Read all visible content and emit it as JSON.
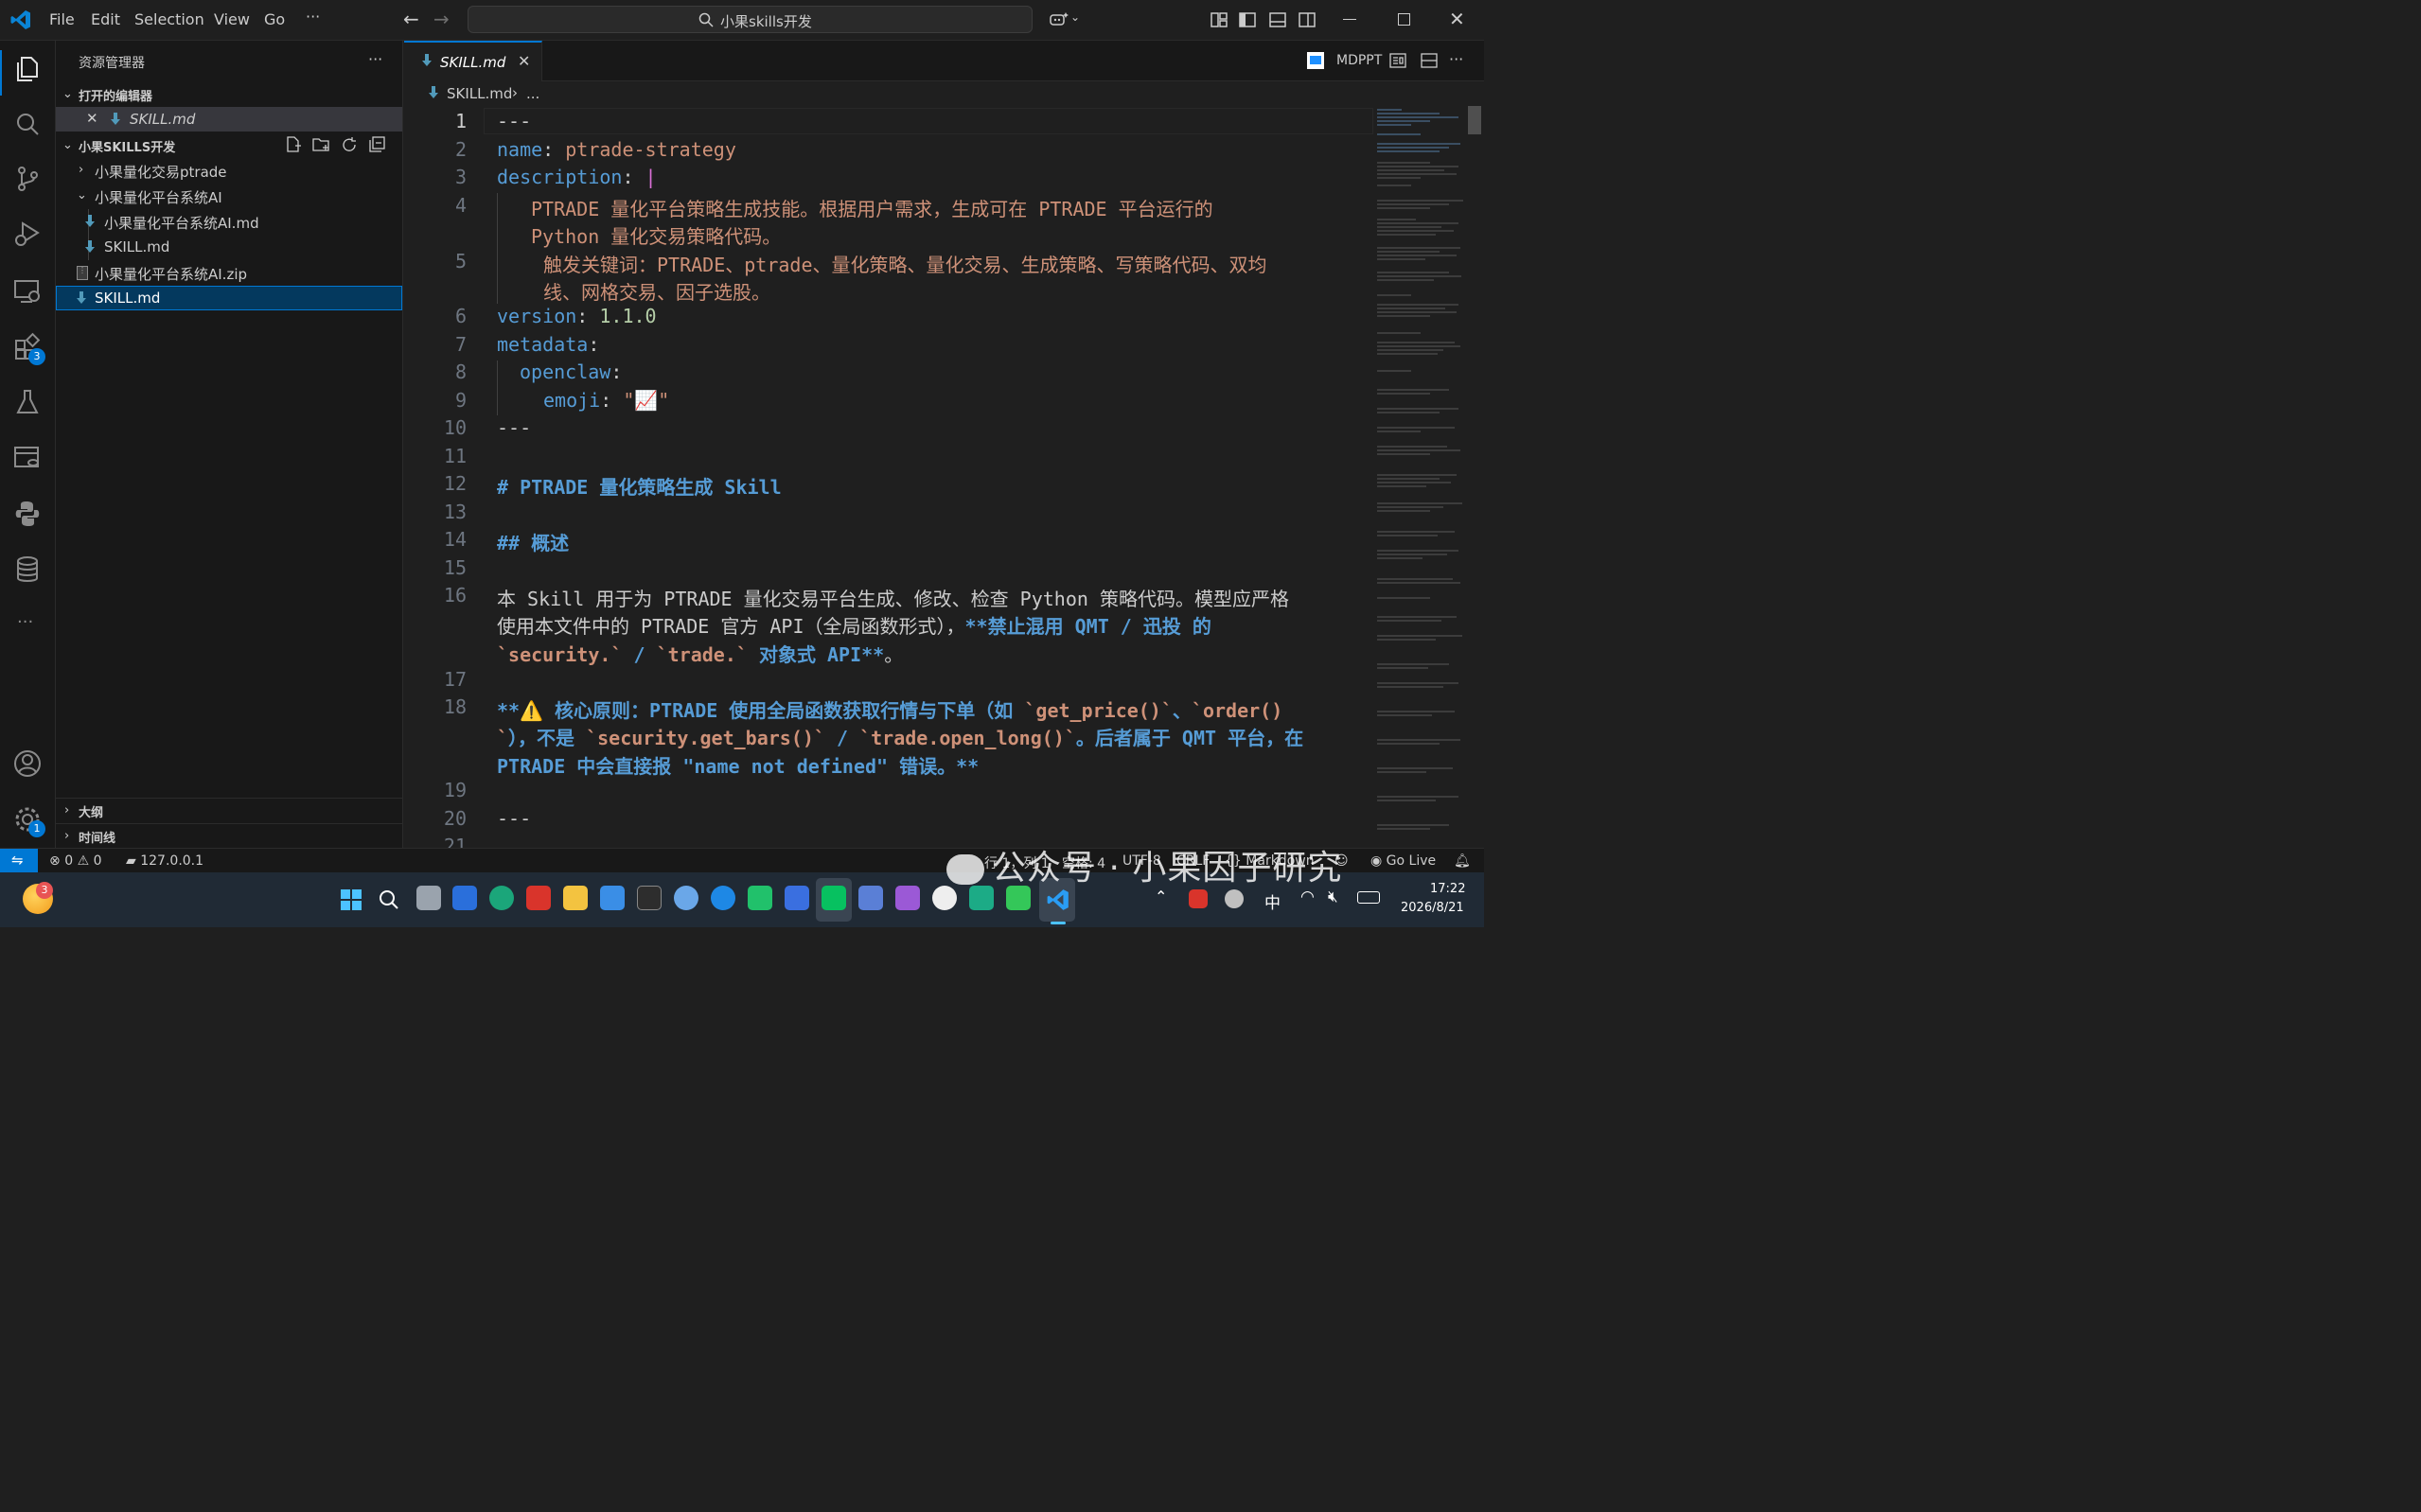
{
  "titlebar": {
    "menu": [
      "File",
      "Edit",
      "Selection",
      "View",
      "Go",
      "···"
    ],
    "search_text": "小果skills开发"
  },
  "activitybar": {
    "extensions_badge": "3",
    "settings_badge": "1"
  },
  "sidebar": {
    "title": "资源管理器",
    "more": "···",
    "open_editors_title": "打开的编辑器",
    "open_editor_file": "SKILL.md",
    "workspace_title": "小果SKILLS开发",
    "tree": [
      "小果量化交易ptrade",
      "小果量化平台系统AI",
      "小果量化平台系统AI.md",
      "SKILL.md",
      "小果量化平台系统AI.zip",
      "SKILL.md"
    ],
    "outline": "大纲",
    "timeline": "时间线"
  },
  "editor": {
    "tab_label": "SKILL.md",
    "mdppt_label": "MDPPT",
    "breadcrumb_file": "SKILL.md",
    "breadcrumb_rest": "...",
    "line_numbers": [
      "1",
      "2",
      "3",
      "4",
      "5",
      "6",
      "7",
      "8",
      "9",
      "10",
      "11",
      "12",
      "13",
      "14",
      "15",
      "16",
      "17",
      "18",
      "19",
      "20",
      "21"
    ],
    "lines": {
      "l1": "---",
      "l2_key": "name",
      "l2_val": "ptrade-strategy",
      "l3_key": "description",
      "l3_val": "|",
      "l4a": "PTRADE 量化平台策略生成技能。根据用户需求，生成可在 PTRADE 平台运行的",
      "l4b": "Python 量化交易策略代码。",
      "l5a": "触发关键词：PTRADE、ptrade、量化策略、量化交易、生成策略、写策略代码、双均",
      "l5b": "线、网格交易、因子选股。",
      "l6_key": "version",
      "l6_val": "1.1.0",
      "l7_key": "metadata",
      "l8_key": "openclaw",
      "l9_key": "emoji",
      "l9_val": "\"📈\"",
      "l10": "---",
      "l12": "# PTRADE 量化策略生成 Skill",
      "l14": "## 概述",
      "l16a": "本 Skill 用于为 PTRADE 量化交易平台生成、修改、检查 Python 策略代码。模型应严格",
      "l16b_plain": "使用本文件中的 PTRADE 官方 API（全局函数形式），",
      "l16b_bold": "**禁止混用 QMT / 迅投 的",
      "l16c_code1": "`security.`",
      "l16c_mid": " / ",
      "l16c_code2": "`trade.`",
      "l16c_bold": " 对象式 API**",
      "l16c_end": "。",
      "l18a_bold": "**⚠️ 核心原则：PTRADE 使用全局函数获取行情与下单（如 ",
      "l18a_c1": "`get_price()`",
      "l18a_sep": "、",
      "l18a_c2": "`order()",
      "l18b_c2": "`",
      "l18b_mid": "），不是 ",
      "l18b_c3": "`security.get_bars()`",
      "l18b_sep": " / ",
      "l18b_c4": "`trade.open_long()`",
      "l18b_end": "。后者属于 QMT 平台，在",
      "l18c": "PTRADE 中会直接报 \"name not defined\" 错误。**",
      "l20": "---"
    }
  },
  "statusbar": {
    "errors": "0",
    "warnings": "0",
    "host": "127.0.0.1",
    "position": "行 1，列 1",
    "spaces": "空格: 4",
    "encoding": "UTF-8",
    "eol": "CRLF",
    "language": "Markdown",
    "golive": "Go Live"
  },
  "taskbar": {
    "weather_badge": "3",
    "time": "17:22",
    "date": "2026/8/21",
    "ime": "中"
  },
  "watermark": "公众号 · 小果因子研究",
  "colors": {
    "accent": "#0078d4",
    "keyword": "#569cd6",
    "string": "#ce9178",
    "number": "#b5cea8"
  }
}
